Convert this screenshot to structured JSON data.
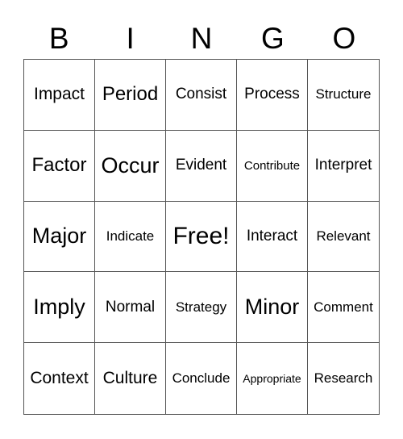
{
  "header": [
    "B",
    "I",
    "N",
    "G",
    "O"
  ],
  "cells": [
    "Impact",
    "Period",
    "Consist",
    "Process",
    "Structure",
    "Factor",
    "Occur",
    "Evident",
    "Contribute",
    "Interpret",
    "Major",
    "Indicate",
    "Free!",
    "Interact",
    "Relevant",
    "Imply",
    "Normal",
    "Strategy",
    "Minor",
    "Comment",
    "Context",
    "Culture",
    "Conclude",
    "Appropriate",
    "Research"
  ]
}
